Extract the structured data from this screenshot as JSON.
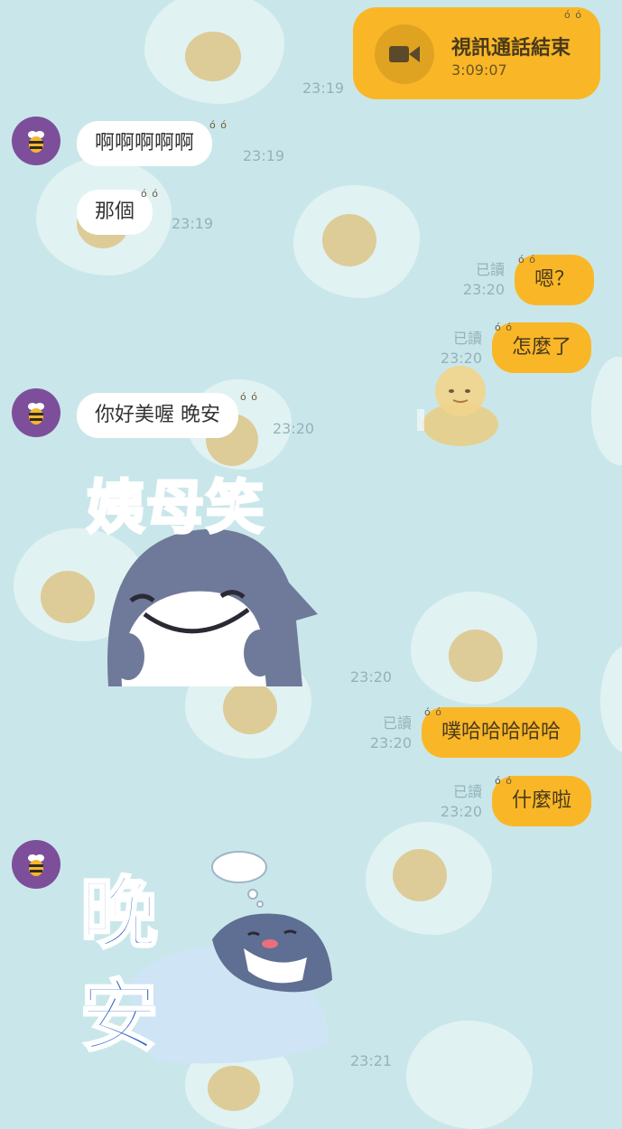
{
  "call": {
    "title": "視訊通話結束",
    "duration": "3:09:07",
    "time": "23:19",
    "icon": "video-camera-icon"
  },
  "messages": [
    {
      "side": "in",
      "text": "啊啊啊啊啊",
      "time": "23:19"
    },
    {
      "side": "in",
      "text": "那個",
      "time": "23:19"
    },
    {
      "side": "out",
      "text": "嗯？",
      "read": "已讀",
      "time": "23:20"
    },
    {
      "side": "out",
      "text": "怎麼了",
      "read": "已讀",
      "time": "23:20"
    },
    {
      "side": "in",
      "text": "你好美喔 晚安",
      "time": "23:20"
    },
    {
      "side": "in",
      "type": "sticker",
      "sticker_text": "姨母笑",
      "time": "23:20"
    },
    {
      "side": "out",
      "text": "噗哈哈哈哈哈",
      "read": "已讀",
      "time": "23:20"
    },
    {
      "side": "out",
      "text": "什麼啦",
      "read": "已讀",
      "time": "23:20"
    },
    {
      "side": "in",
      "type": "sticker",
      "sticker_text_1": "晚",
      "sticker_text_2": "安",
      "time": "23:21"
    }
  ],
  "colors": {
    "background": "#c9e7ea",
    "outgoing_bubble": "#f9b728",
    "incoming_bubble": "#ffffff",
    "avatar": "#7d4f9b",
    "timestamp": "#93b3bb"
  }
}
